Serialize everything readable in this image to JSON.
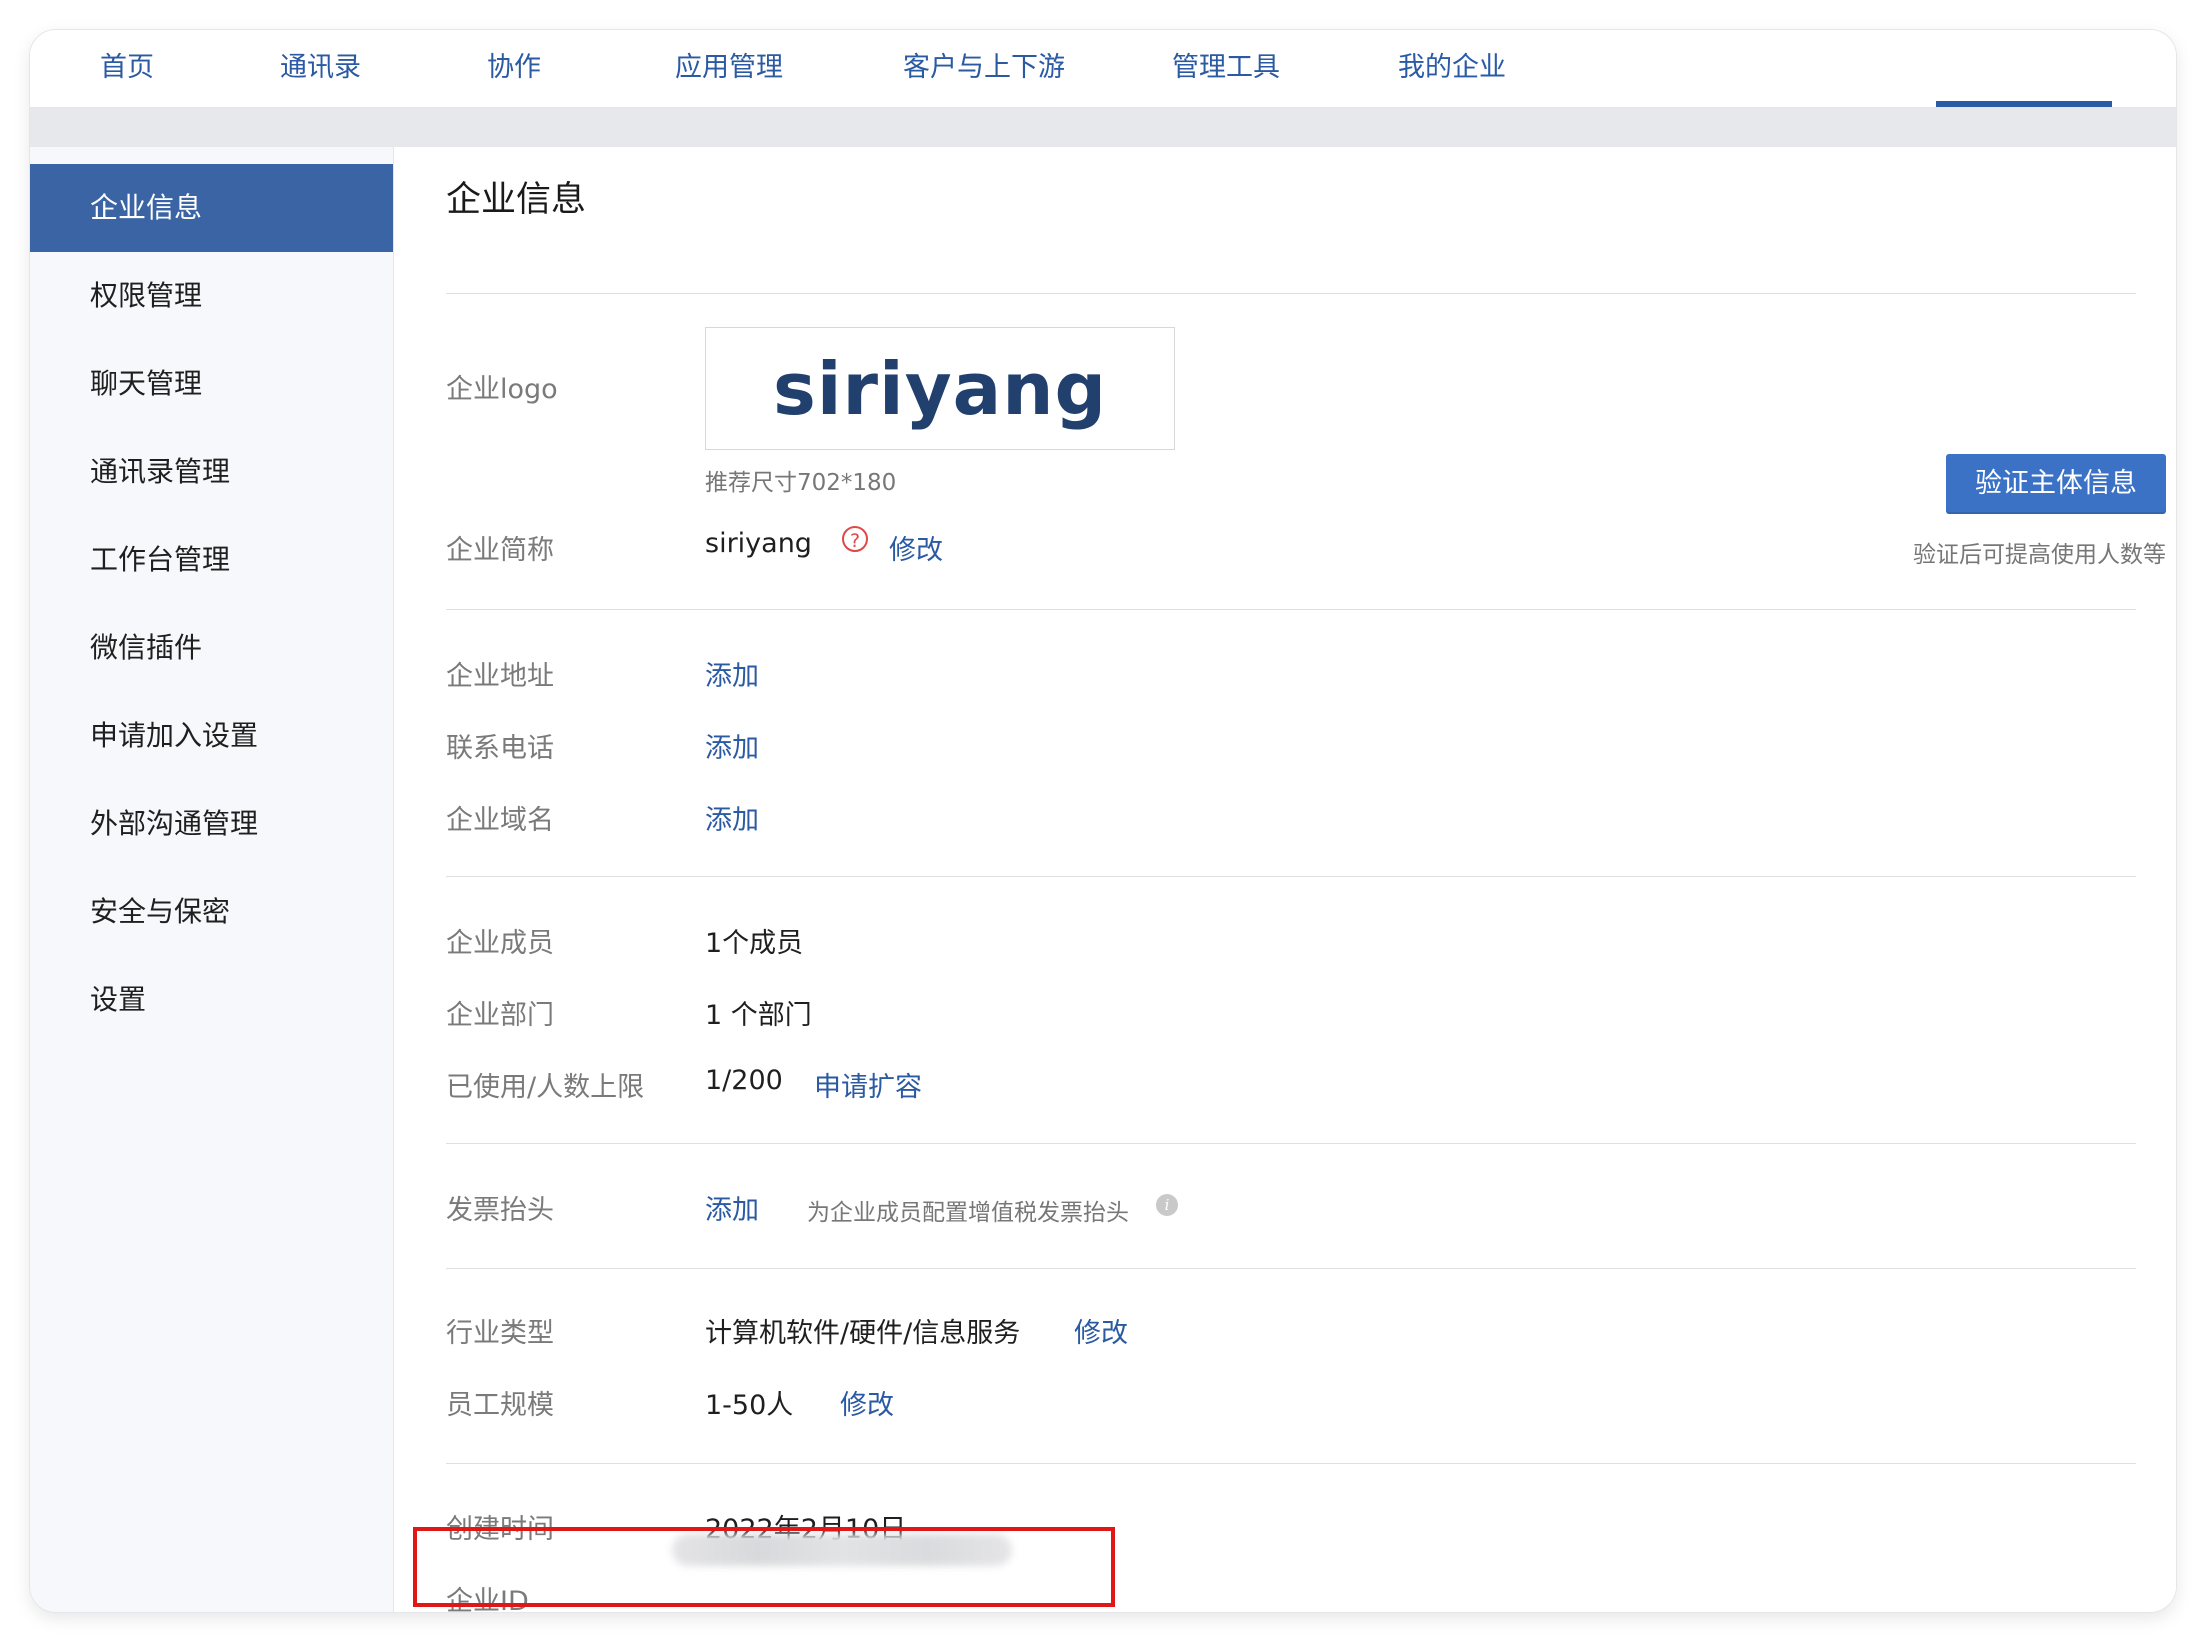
{
  "nav": {
    "items": [
      "首页",
      "通讯录",
      "协作",
      "应用管理",
      "客户与上下游",
      "管理工具",
      "我的企业"
    ],
    "active_index": 6
  },
  "sidebar": {
    "items": [
      "企业信息",
      "权限管理",
      "聊天管理",
      "通讯录管理",
      "工作台管理",
      "微信插件",
      "申请加入设置",
      "外部沟通管理",
      "安全与保密",
      "设置"
    ],
    "active_index": 0
  },
  "page": {
    "title": "企业信息",
    "logo": {
      "label": "企业logo",
      "text": "siriyang",
      "hint": "推荐尺寸702*180"
    },
    "short_name": {
      "label": "企业简称",
      "value": "siriyang",
      "edit": "修改",
      "help_icon": "question-circle-icon"
    },
    "verify": {
      "button": "验证主体信息",
      "note": "验证后可提高使用人数等"
    },
    "address": {
      "label": "企业地址",
      "action": "添加"
    },
    "phone": {
      "label": "联系电话",
      "action": "添加"
    },
    "domain": {
      "label": "企业域名",
      "action": "添加"
    },
    "members": {
      "label": "企业成员",
      "value": "1个成员"
    },
    "departments": {
      "label": "企业部门",
      "value": "1 个部门"
    },
    "usage": {
      "label": "已使用/人数上限",
      "value": "1/200",
      "action": "申请扩容"
    },
    "invoice": {
      "label": "发票抬头",
      "action": "添加",
      "hint": "为企业成员配置增值税发票抬头",
      "info_icon": "info-icon"
    },
    "industry": {
      "label": "行业类型",
      "value": "计算机软件/硬件/信息服务",
      "edit": "修改"
    },
    "scale": {
      "label": "员工规模",
      "value": "1-50人",
      "edit": "修改"
    },
    "created": {
      "label": "创建时间",
      "value": "2022年2月10日"
    },
    "corp_id": {
      "label": "企业ID"
    }
  },
  "colors": {
    "accent": "#2b5aa3",
    "sidebar_active": "#3a64a3",
    "button": "#3b72c6",
    "highlight": "#e01717"
  }
}
